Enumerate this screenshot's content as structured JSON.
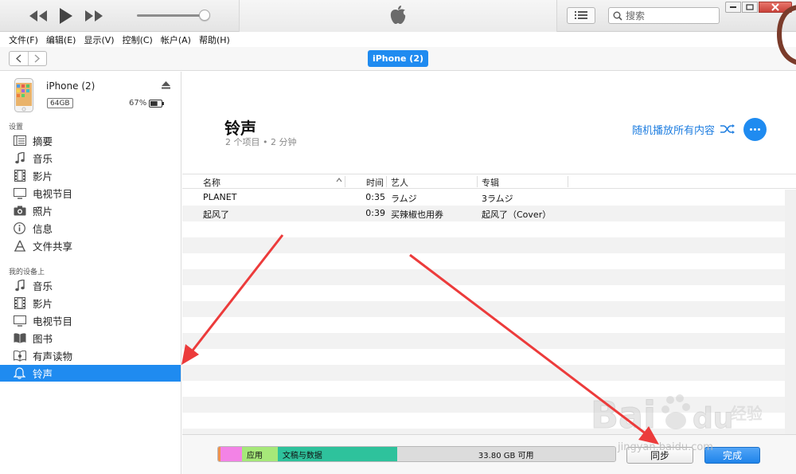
{
  "titlebar": {
    "search_placeholder": "搜索",
    "icons": {
      "prev": "rewind-icon",
      "play": "play-icon",
      "next": "fast-forward-icon",
      "logo": "apple-logo-icon",
      "list": "list-view-icon",
      "search": "search-icon"
    }
  },
  "menu": [
    "文件(F)",
    "编辑(E)",
    "显示(V)",
    "控制(C)",
    "帐户(A)",
    "帮助(H)"
  ],
  "navbar": {
    "device_label": "iPhone (2)"
  },
  "device": {
    "name": "iPhone (2)",
    "capacity": "64GB",
    "battery": "67%",
    "battery_level": 0.67
  },
  "sidebar": {
    "settings_header": "设置",
    "settings_items": [
      {
        "label": "摘要",
        "icon": "summary-icon"
      },
      {
        "label": "音乐",
        "icon": "music-note-icon"
      },
      {
        "label": "影片",
        "icon": "film-icon"
      },
      {
        "label": "电视节目",
        "icon": "tv-icon"
      },
      {
        "label": "照片",
        "icon": "camera-icon"
      },
      {
        "label": "信息",
        "icon": "info-icon"
      },
      {
        "label": "文件共享",
        "icon": "file-sharing-icon"
      }
    ],
    "ondevice_header": "我的设备上",
    "ondevice_items": [
      {
        "label": "音乐",
        "icon": "music-note-icon"
      },
      {
        "label": "影片",
        "icon": "film-icon"
      },
      {
        "label": "电视节目",
        "icon": "tv-icon"
      },
      {
        "label": "图书",
        "icon": "book-icon"
      },
      {
        "label": "有声读物",
        "icon": "audiobook-icon"
      },
      {
        "label": "铃声",
        "icon": "bell-icon",
        "active": true
      }
    ]
  },
  "main": {
    "title": "铃声",
    "subtitle": "2 个项目 • 2 分钟",
    "shuffle_label": "随机播放所有内容"
  },
  "table": {
    "columns": {
      "name": "名称",
      "time": "时间",
      "artist": "艺人",
      "album": "专辑"
    },
    "rows": [
      {
        "name": "PLANET",
        "time": "0:35",
        "artist": "ラムジ",
        "album": "3ラムジ"
      },
      {
        "name": "起风了",
        "time": "0:39",
        "artist": "买辣椒也用券",
        "album": "起风了（Cover）"
      }
    ]
  },
  "storage": {
    "segments": [
      {
        "label": "",
        "color": "#f0914f",
        "fraction": 0.006
      },
      {
        "label": "",
        "color": "#f383e6",
        "fraction": 0.054
      },
      {
        "label": "应用",
        "color": "#a6e879",
        "fraction": 0.09
      },
      {
        "label": "文稿与数据",
        "color": "#2ec29c",
        "fraction": 0.3
      },
      {
        "label": "33.80 GB 可用",
        "color": "#dcdcdc",
        "fraction": 0.55
      }
    ]
  },
  "buttons": {
    "sync": "同步",
    "done": "完成"
  },
  "watermark": {
    "logo_text": "Bai du 经验",
    "sub_text": "jingyan.baidu.com"
  },
  "colors": {
    "accent": "#1f8bf0",
    "arrow": "#ec3b3b"
  }
}
